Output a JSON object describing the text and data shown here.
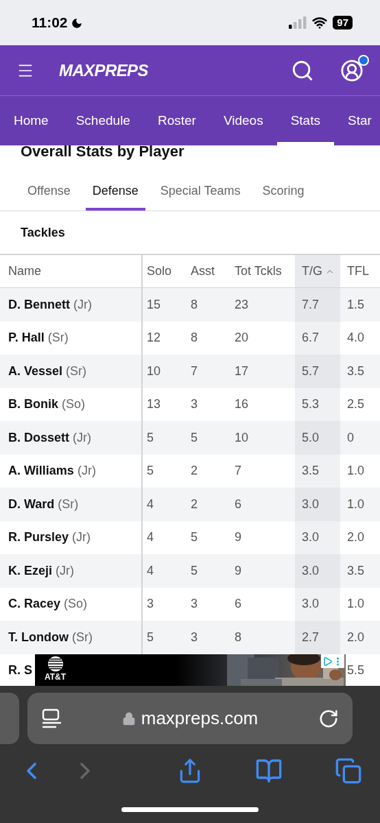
{
  "status_bar": {
    "time": "11:02",
    "battery": "97",
    "do_not_disturb": true
  },
  "header": {
    "logo": "MAXPREPS",
    "notification_dot": true
  },
  "nav": [
    {
      "label": "Home",
      "selected": false
    },
    {
      "label": "Schedule",
      "selected": false
    },
    {
      "label": "Roster",
      "selected": false
    },
    {
      "label": "Videos",
      "selected": false
    },
    {
      "label": "Stats",
      "selected": true
    },
    {
      "label": "Star",
      "selected": false
    }
  ],
  "page_title": "Overall Stats by Player",
  "stat_tabs": [
    {
      "label": "Offense",
      "selected": false
    },
    {
      "label": "Defense",
      "selected": true
    },
    {
      "label": "Special Teams",
      "selected": false
    },
    {
      "label": "Scoring",
      "selected": false
    }
  ],
  "section_title": "Tackles",
  "table": {
    "columns": [
      {
        "label": "Name",
        "sorted": false
      },
      {
        "label": "Solo",
        "sorted": false
      },
      {
        "label": "Asst",
        "sorted": false
      },
      {
        "label": "Tot Tckls",
        "sorted": false
      },
      {
        "label": "T/G",
        "sorted": true
      },
      {
        "label": "TFL",
        "sorted": false
      }
    ],
    "rows": [
      {
        "year": "(Jr)",
        "cells": [
          "D. Bennett",
          "15",
          "8",
          "23",
          "7.7",
          "1.5"
        ]
      },
      {
        "year": "(Sr)",
        "cells": [
          "P. Hall",
          "12",
          "8",
          "20",
          "6.7",
          "4.0"
        ]
      },
      {
        "year": "(Sr)",
        "cells": [
          "A. Vessel",
          "10",
          "7",
          "17",
          "5.7",
          "3.5"
        ]
      },
      {
        "year": "(So)",
        "cells": [
          "B. Bonik",
          "13",
          "3",
          "16",
          "5.3",
          "2.5"
        ]
      },
      {
        "year": "(Jr)",
        "cells": [
          "B. Dossett",
          "5",
          "5",
          "10",
          "5.0",
          "0"
        ]
      },
      {
        "year": "(Jr)",
        "cells": [
          "A. Williams",
          "5",
          "2",
          "7",
          "3.5",
          "1.0"
        ]
      },
      {
        "year": "(Sr)",
        "cells": [
          "D. Ward",
          "4",
          "2",
          "6",
          "3.0",
          "1.0"
        ]
      },
      {
        "year": "(Jr)",
        "cells": [
          "R. Pursley",
          "4",
          "5",
          "9",
          "3.0",
          "2.0"
        ]
      },
      {
        "year": "(Jr)",
        "cells": [
          "K. Ezeji",
          "4",
          "5",
          "9",
          "3.0",
          "3.5"
        ]
      },
      {
        "year": "(So)",
        "cells": [
          "C. Racey",
          "3",
          "3",
          "6",
          "3.0",
          "1.0"
        ]
      },
      {
        "year": "(Sr)",
        "cells": [
          "T. Londow",
          "5",
          "3",
          "8",
          "2.7",
          "2.0"
        ]
      },
      {
        "cells": [
          "R. S",
          null,
          null,
          null,
          null,
          "5.5"
        ]
      }
    ]
  },
  "ad": {
    "brand": "AT&T",
    "kind": "picture"
  },
  "browser": {
    "url": "maxpreps.com",
    "secure": true,
    "back_enabled": true,
    "forward_enabled": false
  }
}
